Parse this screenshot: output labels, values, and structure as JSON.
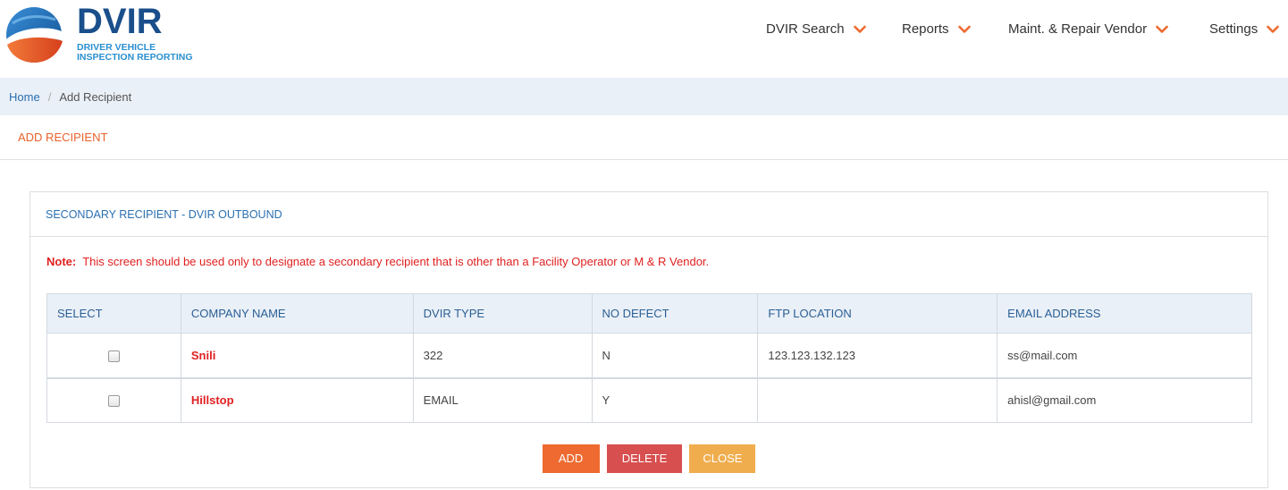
{
  "logo": {
    "title": "DVIR",
    "sub_line1": "DRIVER VEHICLE",
    "sub_line2": "INSPECTION REPORTING"
  },
  "nav": {
    "items": [
      {
        "label": "DVIR Search",
        "icon": "chevron-down-icon"
      },
      {
        "label": "Reports",
        "icon": "chevron-down-icon"
      },
      {
        "label": "Maint. & Repair Vendor",
        "icon": "chevron-down-icon"
      },
      {
        "label": "Settings",
        "icon": "chevron-down-icon"
      }
    ]
  },
  "breadcrumb": {
    "home": "Home",
    "separator": "/",
    "current": "Add Recipient"
  },
  "page": {
    "title": "ADD RECIPIENT"
  },
  "panel": {
    "heading": "SECONDARY RECIPIENT - DVIR OUTBOUND",
    "note_label": "Note:",
    "note_text": "This screen should be used only to designate a secondary recipient that is other than a Facility Operator or M & R Vendor."
  },
  "table": {
    "columns": [
      "SELECT",
      "COMPANY NAME",
      "DVIR TYPE",
      "NO DEFECT",
      "FTP LOCATION",
      "EMAIL ADDRESS"
    ],
    "rows": [
      {
        "selected": false,
        "company": "Snili",
        "dvir_type": "322",
        "no_defect": "N",
        "ftp_location": "123.123.132.123",
        "email": "ss@mail.com"
      },
      {
        "selected": false,
        "company": "Hillstop",
        "dvir_type": "EMAIL",
        "no_defect": "Y",
        "ftp_location": "",
        "email": "ahisl@gmail.com"
      }
    ]
  },
  "buttons": {
    "add": "ADD",
    "delete": "DELETE",
    "close": "CLOSE"
  },
  "colors": {
    "accent_orange": "#ee6a30",
    "delete_red": "#d84f4f",
    "close_amber": "#f0ad4e",
    "note_red": "#e02020",
    "link_blue": "#2a6fb0",
    "logo_navy": "#1a4f8b"
  }
}
